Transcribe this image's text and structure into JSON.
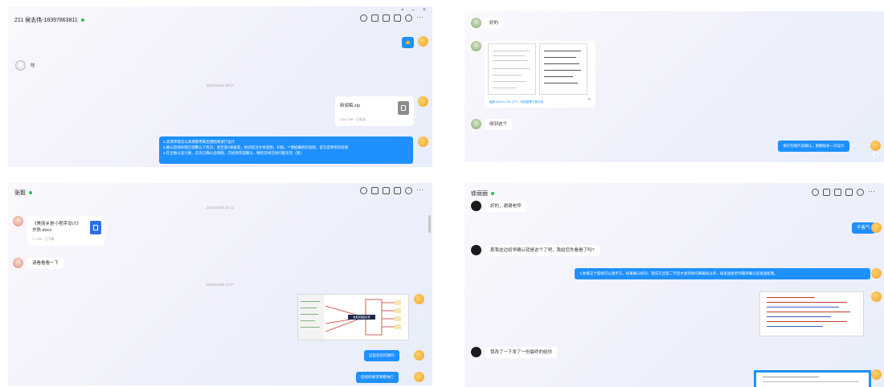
{
  "colors": {
    "accent": "#1e90ff",
    "online": "#2bbf5b"
  },
  "panel1": {
    "title": "211 侯志伟-18397863811",
    "window_controls": [
      "▪",
      "–",
      "×"
    ],
    "msg_sheep": "哇",
    "timestamp": "2024/11/28 09:47",
    "file_name": "新闻稿.zip",
    "file_meta": "126.7 KB · 已发送",
    "blue_lines": [
      "1.高清单建议以本期使用来出镜图来进行设计",
      "2.确认后线条图已调整以下各页，发至第3张备案，拍近前注文本后图，扫描，**请拍摄各阶段图，首页还原各阶段图",
      "3.在全做以设计图，首页已确认出镜图，交给我完成确认，精检近修已经问题页签（图）"
    ]
  },
  "panel2": {
    "msg1": "好的",
    "image_caption": "截屏 2024-12-05 上午1 - 样品整理下载文档",
    "msg2": "收到这个",
    "blue_msg": "请在有图片前确认，要删除多一页设计",
    "read_receipt": "1"
  },
  "panel3": {
    "title": "张毅",
    "timestamp1": "2024/12/02 16:11",
    "file_name_line1": "《美丽乡是小程序设计》",
    "file_name_line2": "东陈.docx",
    "file_meta": "7.7 KB · 已下载",
    "msg_girl": "请看看看一下",
    "timestamp2": "2024/12/05 13:27",
    "diagram_label": "数据流程图示意",
    "blue_msg1": "这里还有问题吗",
    "blue_msg2": "后续的要求请看你们"
  },
  "panel4": {
    "title": "徐丽丽",
    "msg1": "好的，谢谢老师",
    "blue_msg1": "不客气",
    "msg2": "那我这边初学确认就是这个了吧，我给您先看看了吗?",
    "blue_msg2": "1.你看这个提纲可以逐步写，如果确认好的，我先写出第二节后才发到你的邮箱再过审，再发送给老师最终确认后发送给我。",
    "msg3": "我改了一下发了一份最终的给你"
  }
}
